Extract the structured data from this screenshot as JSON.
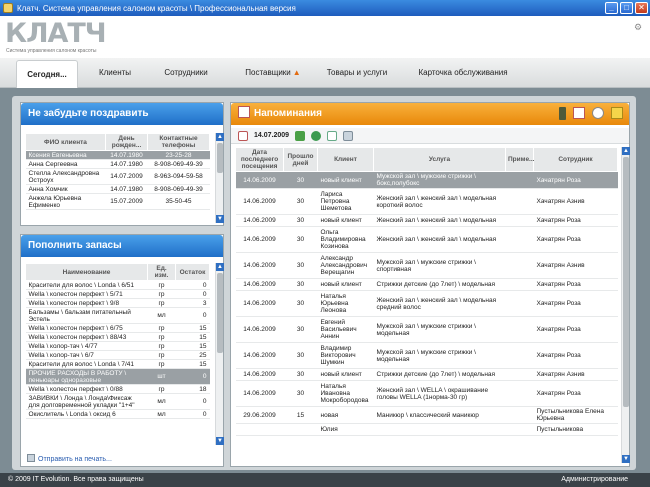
{
  "window": {
    "title": "Клатч. Система управления салоном красоты \\ Профессиональная версия"
  },
  "header": {
    "logo": "КЛАТЧ",
    "logo_subtitle": "Система управления салоном красоты"
  },
  "nav": {
    "tabs": [
      {
        "label": "Сегодня..."
      },
      {
        "label": "Клиенты"
      },
      {
        "label": "Сотрудники"
      },
      {
        "label": "Поставщики"
      },
      {
        "label": "Товары и услуги"
      },
      {
        "label": "Карточка обслуживания"
      }
    ]
  },
  "birthdays": {
    "title": "Не забудьте поздравить",
    "columns": [
      "ФИО клиента",
      "День рожден...",
      "Контактные телефоны"
    ],
    "rows": [
      [
        "Ксения Евгеньевна",
        "14.07.1980",
        "23-25-28"
      ],
      [
        "Анна Сергеевна",
        "14.07.1980",
        "8-908-069-49-39"
      ],
      [
        "Стелла Александровна Остроух",
        "14.07.2009",
        "8-963-094-59-58"
      ],
      [
        "Анна Хомчик",
        "14.07.1980",
        "8-908-069-49-39"
      ],
      [
        "Анжела Юрьевна Ефименко",
        "15.07.2009",
        "35-50-45"
      ]
    ]
  },
  "stock": {
    "title": "Пополнить запасы",
    "columns": [
      "Наименование",
      "Ед. изм.",
      "Остаток"
    ],
    "rows": [
      [
        "Красители для волос \\ Londa \\ 6/51",
        "гр",
        "0"
      ],
      [
        "Wella \\ колестон перфект \\ 5/71",
        "гр",
        "0"
      ],
      [
        "Wella \\ колестон перфект \\ 9/8",
        "гр",
        "3"
      ],
      [
        "Бальзамы \\ бальзам питательный Эстель",
        "мл",
        "0"
      ],
      [
        "Wella \\ колестон перфект \\ 6/75",
        "гр",
        "15"
      ],
      [
        "Wella \\ колестон перфект \\ 88/43",
        "гр",
        "15"
      ],
      [
        "Wella \\ колор-тач \\ 4/77",
        "гр",
        "15"
      ],
      [
        "Wella \\ колор-тач \\ 6/7",
        "гр",
        "25"
      ],
      [
        "Красители для волос \\ Londa \\ 7/41",
        "гр",
        "15"
      ],
      [
        "ПРОЧИЕ РАСХОДЫ В РАБОТУ \\ пеньюары одноразовые",
        "шт",
        "0"
      ],
      [
        "Wella \\ колестон перфект \\ 0/88",
        "гр",
        "18"
      ],
      [
        "ЗАВИВКИ \\ Лонда \\ Лонда\\Фиксаж для долговременной укладки \"1+4\"",
        "мл",
        "0"
      ],
      [
        "Окислитель \\ Londa \\ оксид 6",
        "мл",
        "0"
      ]
    ],
    "print_label": "Отправить на печать..."
  },
  "reminders": {
    "title": "Напоминания",
    "date": "14.07.2009",
    "columns": [
      "Дата последнего посещения",
      "Прошло дней",
      "Клиент",
      "Услуга",
      "Приме...",
      "Сотрудник"
    ],
    "rows": [
      [
        "14.06.2009",
        "30",
        "новый клиент",
        "Мужской зал \\ мужские стрижки \\ бокс,полубокс",
        "",
        "Хачатрян Роза"
      ],
      [
        "14.06.2009",
        "30",
        "Лариса Петровна Шеметова",
        "Женский зал \\ женский зал \\ модельная короткий волос",
        "",
        "Хачатрян Азнив"
      ],
      [
        "14.06.2009",
        "30",
        "новый клиент",
        "Женский зал \\ женский зал \\ модельная",
        "",
        "Хачатрян Роза"
      ],
      [
        "14.06.2009",
        "30",
        "Ольга Владимировна Козинова",
        "Женский зал \\ женский зал \\ модельная",
        "",
        "Хачатрян Роза"
      ],
      [
        "14.06.2009",
        "30",
        "Александр Александрович Верещагин",
        "Мужской зал \\ мужские стрижки \\ спортивная",
        "",
        "Хачатрян Азнив"
      ],
      [
        "14.06.2009",
        "30",
        "новый клиент",
        "Стрижки детские (до 7лет) \\ модельная",
        "",
        "Хачатрян Роза"
      ],
      [
        "14.06.2009",
        "30",
        "Наталья Юрьевна Леонова",
        "Женский зал \\ женский зал \\ модельная средний волос",
        "",
        "Хачатрян Роза"
      ],
      [
        "14.06.2009",
        "30",
        "Евгений Васильевич Аннин",
        "Мужской зал \\ мужские стрижки \\ модельная",
        "",
        "Хачатрян Роза"
      ],
      [
        "14.06.2009",
        "30",
        "Владимир Викторович Шумкин",
        "Мужской зал \\ мужские стрижки \\ модельная",
        "",
        "Хачатрян Роза"
      ],
      [
        "14.06.2009",
        "30",
        "новый клиент",
        "Стрижки детские (до 7лет) \\ модельная",
        "",
        "Хачатрян Азнив"
      ],
      [
        "14.06.2009",
        "30",
        "Наталья Ивановна Мокробородова",
        "Женский зал \\ WELLA \\ окрашивание головы WELLA (1норма-30 гр)",
        "",
        "Хачатрян Роза"
      ],
      [
        "29.06.2009",
        "15",
        "новая",
        "Маникюр \\ классический маникюр",
        "",
        "Пустыльникова Елена Юрьевна"
      ],
      [
        "",
        "",
        "Юлия",
        "",
        "",
        "Пустыльникова"
      ]
    ]
  },
  "statusbar": {
    "copyright": "© 2009 IT Evolution. Все права защищены",
    "user": "Администрирование"
  }
}
